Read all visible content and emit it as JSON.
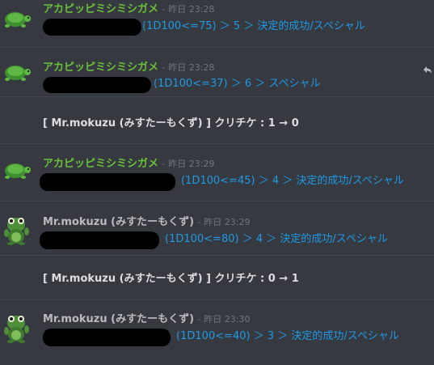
{
  "messages": [
    {
      "author": "アカピッピミシミシガメ",
      "sep": "-",
      "time": "昨日 23:28",
      "roll": "(1D100<=75) ＞ 5 ＞ 決定的成功/スペシャル"
    },
    {
      "author": "アカピッピミシミシガメ",
      "sep": "-",
      "time": "昨日 23:28",
      "roll": "(1D100<=37) ＞ 6 ＞ スペシャル"
    },
    {
      "system": "[ Mr.mokuzu (みすたーもくず) ] クリチケ : 1 → 0"
    },
    {
      "author": "アカピッピミシミシガメ",
      "sep": "-",
      "time": "昨日 23:29",
      "roll": "(1D100<=45) ＞ 4 ＞ 決定的成功/スペシャル"
    },
    {
      "author": "Mr.mokuzu (みすたーもくず)",
      "sep": "-",
      "time": "昨日 23:29",
      "roll": "(1D100<=80) ＞ 4 ＞ 決定的成功/スペシャル"
    },
    {
      "system": "[ Mr.mokuzu (みすたーもくず) ] クリチケ : 0 → 1"
    },
    {
      "author": "Mr.mokuzu (みすたーもくず)",
      "sep": "-",
      "time": "昨日 23:30",
      "roll": "(1D100<=40) ＞ 3 ＞ 決定的成功/スペシャル"
    }
  ],
  "icons": {
    "turtle": "turtle-avatar-icon",
    "frog": "frog-avatar-icon",
    "reply": "reply-arrow-icon"
  },
  "colors": {
    "background": "#36393f",
    "author_turtle": "#6abf3b",
    "author_mokuzu": "#b9bbbe",
    "roll": "#1e9ae6",
    "timestamp": "#72767d"
  }
}
